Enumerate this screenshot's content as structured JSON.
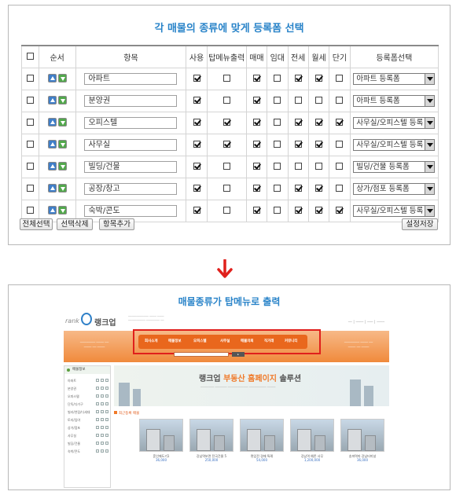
{
  "form_panel": {
    "title": "각 매물의 종류에 맞게 등록폼 선택",
    "headers": [
      "순서",
      "항목",
      "사용",
      "탑메뉴출력",
      "매매",
      "임대",
      "전세",
      "월세",
      "단기",
      "등록폼선택"
    ],
    "rows": [
      {
        "name": "아파트",
        "use": true,
        "topmenu": false,
        "sale": true,
        "lease": false,
        "jeonse": true,
        "wolse": true,
        "short": false,
        "form": "아파트 등록폼"
      },
      {
        "name": "분양권",
        "use": true,
        "topmenu": false,
        "sale": true,
        "lease": false,
        "jeonse": false,
        "wolse": false,
        "short": false,
        "form": "아파트 등록폼"
      },
      {
        "name": "오피스텔",
        "use": true,
        "topmenu": true,
        "sale": true,
        "lease": false,
        "jeonse": true,
        "wolse": true,
        "short": true,
        "form": "사무실/오피스텔 등록"
      },
      {
        "name": "사무실",
        "use": true,
        "topmenu": true,
        "sale": true,
        "lease": false,
        "jeonse": true,
        "wolse": true,
        "short": false,
        "form": "사무실/오피스텔 등록"
      },
      {
        "name": "빌딩/건물",
        "use": true,
        "topmenu": false,
        "sale": true,
        "lease": false,
        "jeonse": false,
        "wolse": false,
        "short": false,
        "form": "빌딩/건물 등록폼"
      },
      {
        "name": "공장/창고",
        "use": true,
        "topmenu": false,
        "sale": true,
        "lease": false,
        "jeonse": true,
        "wolse": true,
        "short": false,
        "form": "상가/점포 등록폼"
      },
      {
        "name": "숙박/콘도",
        "use": true,
        "topmenu": false,
        "sale": true,
        "lease": false,
        "jeonse": true,
        "wolse": true,
        "short": true,
        "form": "사무실/오피스텔 등록"
      }
    ],
    "buttons": {
      "select_all": "전체선택",
      "delete_selected": "선택삭제",
      "add_item": "항목추가",
      "save_settings": "설정저장"
    }
  },
  "preview_panel": {
    "title": "매물종류가 탑메뉴로 출력",
    "site": {
      "logo_text": "rank",
      "logo_kor": "랭크업",
      "nav_items": [
        "회사소개",
        "매물정보",
        "오피스텔",
        "사무실",
        "매물의뢰",
        "직거래",
        "커뮤니티"
      ],
      "sidebar_title": "매물정보",
      "sidebar_items": [
        "아파트",
        "분양권",
        "오피스텔",
        "단독/다가구",
        "빌라/연립/다세대",
        "토지/임야",
        "상가/점포",
        "사무실",
        "빌딩/건물",
        "숙박/콘도"
      ],
      "banner_prefix": "랭크업 ",
      "banner_highlight": "부동산 홈페이지",
      "banner_suffix": " 솔루션",
      "recent_title": "최근등록 매물",
      "listings": [
        {
          "title": "혼인매도기1",
          "price": "36,000"
        },
        {
          "title": "강남역보면 전국건물 5",
          "price": "250,000"
        },
        {
          "title": "편입전 경매 특례",
          "price": "54,000"
        },
        {
          "title": "강남역 예존 사무",
          "price": "1,200,000"
        },
        {
          "title": "송파역마 강남터미널",
          "price": "36,000"
        }
      ]
    }
  },
  "colors": {
    "title_blue": "#2a84c9",
    "nav_orange": "#f08a3c",
    "highlight_red": "#e0201c"
  }
}
